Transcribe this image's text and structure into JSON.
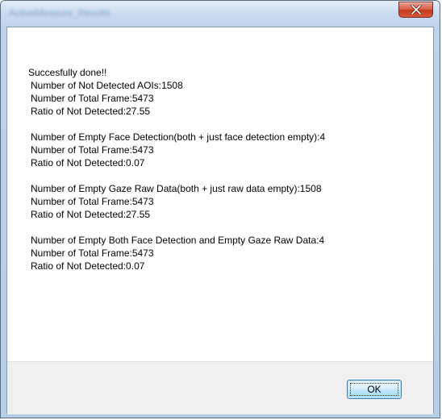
{
  "window": {
    "title": "ActiveMeasure_Results"
  },
  "message": {
    "lines": [
      "Succesfully done!!",
      " Number of Not Detected AOIs:1508",
      " Number of Total Frame:5473",
      " Ratio of Not Detected:27.55",
      "",
      " Number of Empty Face Detection(both + just face detection empty):4",
      " Number of Total Frame:5473",
      " Ratio of Not Detected:0.07",
      "",
      " Number of Empty Gaze Raw Data(both + just raw data empty):1508",
      " Number of Total Frame:5473",
      " Ratio of Not Detected:27.55",
      "",
      " Number of Empty Both Face Detection and Empty Gaze Raw Data:4",
      " Number of Total Frame:5473",
      " Ratio of Not Detected:0.07"
    ]
  },
  "buttons": {
    "ok_label": "OK"
  },
  "icons": {
    "close": "close-icon"
  }
}
